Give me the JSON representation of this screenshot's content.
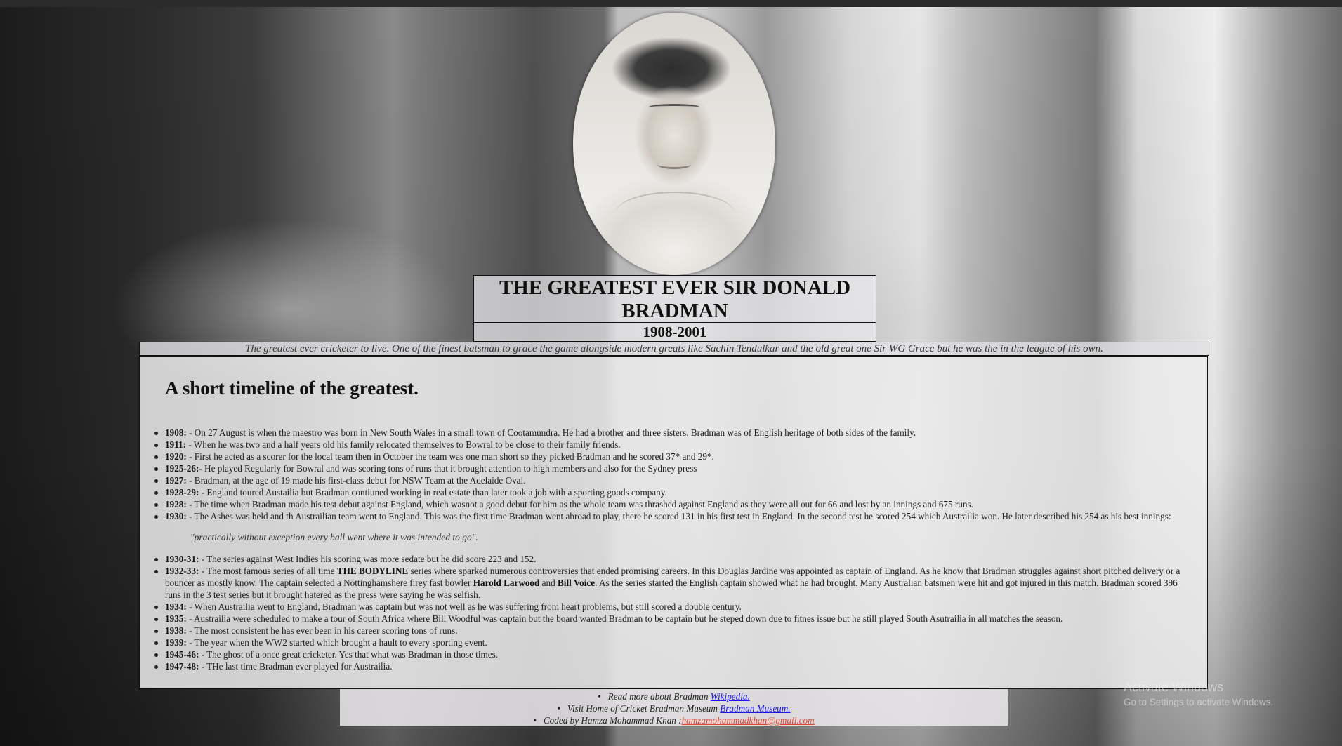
{
  "header": {
    "title": "THE GREATEST EVER SIR DONALD BRADMAN",
    "years": "1908-2001",
    "tagline": "The greatest ever cricketer to live. One of the finest batsman to grace the game alongside modern greats like Sachin Tendulkar and the old great one Sir WG Grace but he was the in the league of his own."
  },
  "timeline": {
    "heading": "A short timeline of the greatest.",
    "items_before_quote": [
      {
        "year": "1908:",
        "text": " - On 27 August is when the maestro was born in New South Wales in a small town of Cootamundra. He had a brother and three sisters. Bradman was of English heritage of both sides of the family."
      },
      {
        "year": "1911:",
        "text": " - When he was two and a half years old his family relocated themselves to Bowral to be close to their family friends."
      },
      {
        "year": "1920:",
        "text": " - First he acted as a scorer for the local team then in October the team was one man short so they picked Bradman and he scored 37* and 29*."
      },
      {
        "year": "1925-26:",
        "text": "- He played Regularly for Bowral and was scoring tons of runs that it brought attention to high members and also for the Sydney press"
      },
      {
        "year": "1927:",
        "text": " - Bradman, at the age of 19 made his first-class debut for NSW Team at the Adelaide Oval."
      },
      {
        "year": "1928-29:",
        "text": " - England toured Austailia but Bradman contiuned working in real estate than later took a job with a sporting goods company."
      },
      {
        "year": "1928:",
        "text": " - The time when Bradman made his test debut against England, which wasnot a good debut for him as the whole team was thrashed against England as they were all out for 66 and lost by an innings and 675 runs."
      },
      {
        "year": "1930:",
        "text": " - The Ashes was held and th Austrailian team went to England. This was the first time Bradman went abroad to play, there he scored 131 in his first test in England. In the second test he scored 254 which Austrailia won. He later described his 254 as his best innings:"
      }
    ],
    "quote": "\"practically without exception every ball went where it was intended to go\".",
    "item_1930_31": {
      "year": "1930-31:",
      "text": " - The series against West Indies his scoring was more sedate but he did score 223 and 152."
    },
    "item_1932_33": {
      "year": "1932-33:",
      "t1": " - The most famous series of all time ",
      "b1": "THE BODYLINE",
      "t2": " series where sparked numerous controversies that ended promising careers. In this Douglas Jardine was appointed as captain of England. As he know that Bradman struggles against short pitched delivery or a bouncer as mostly know. The captain selected a Nottinghamshere firey fast bowler ",
      "b2": "Harold Larwood",
      "t3": " and ",
      "b3": "Bill Voice",
      "t4": ". As the series started the English captain showed what he had brought. Many Australian batsmen were hit and got injured in this match. Bradman scored 396 runs in the 3 test series but it brought hatered as the press were saying he was selfish."
    },
    "items_after": [
      {
        "year": "1934:",
        "text": " - When Austrailia went to England, Bradman was captain but was not well as he was suffering from heart problems, but still scored a double century."
      },
      {
        "year": "1935:",
        "text": " - Austrailia were scheduled to make a tour of South Africa where Bill Woodful was captain but the board wanted Bradman to be captain but he steped down due to fitnes issue but he still played South Asutrailia in all matches the season."
      },
      {
        "year": "1938:",
        "text": " - The most consistent he has ever been in his career scoring tons of runs."
      },
      {
        "year": "1939:",
        "text": " - The year when the WW2 started which brought a hault to every sporting event."
      },
      {
        "year": "1945-46:",
        "text": " - The ghost of a once great cricketer. Yes that what was Bradman in those times."
      },
      {
        "year": "1947-48:",
        "text": " - THe last time Bradman ever played for Austrailia."
      }
    ]
  },
  "footer": {
    "line1_text": "Read more about Bradman ",
    "line1_link": "Wikipedia.",
    "line2_text": "Visit Home of Cricket Bradman Museum ",
    "line2_link": "Bradman Museum.",
    "line3_text": "Coded by Hamza Mohammad Khan :",
    "line3_link": "hamzamohammadkhan@gmail.com"
  },
  "os_overlay": {
    "activate_title": "Activate Windows",
    "activate_sub": "Go to Settings to activate Windows."
  },
  "colors": {
    "link_blue": "#1a1aee",
    "link_red": "#e0482a"
  },
  "icons": {
    "portrait": "portrait-photo"
  }
}
